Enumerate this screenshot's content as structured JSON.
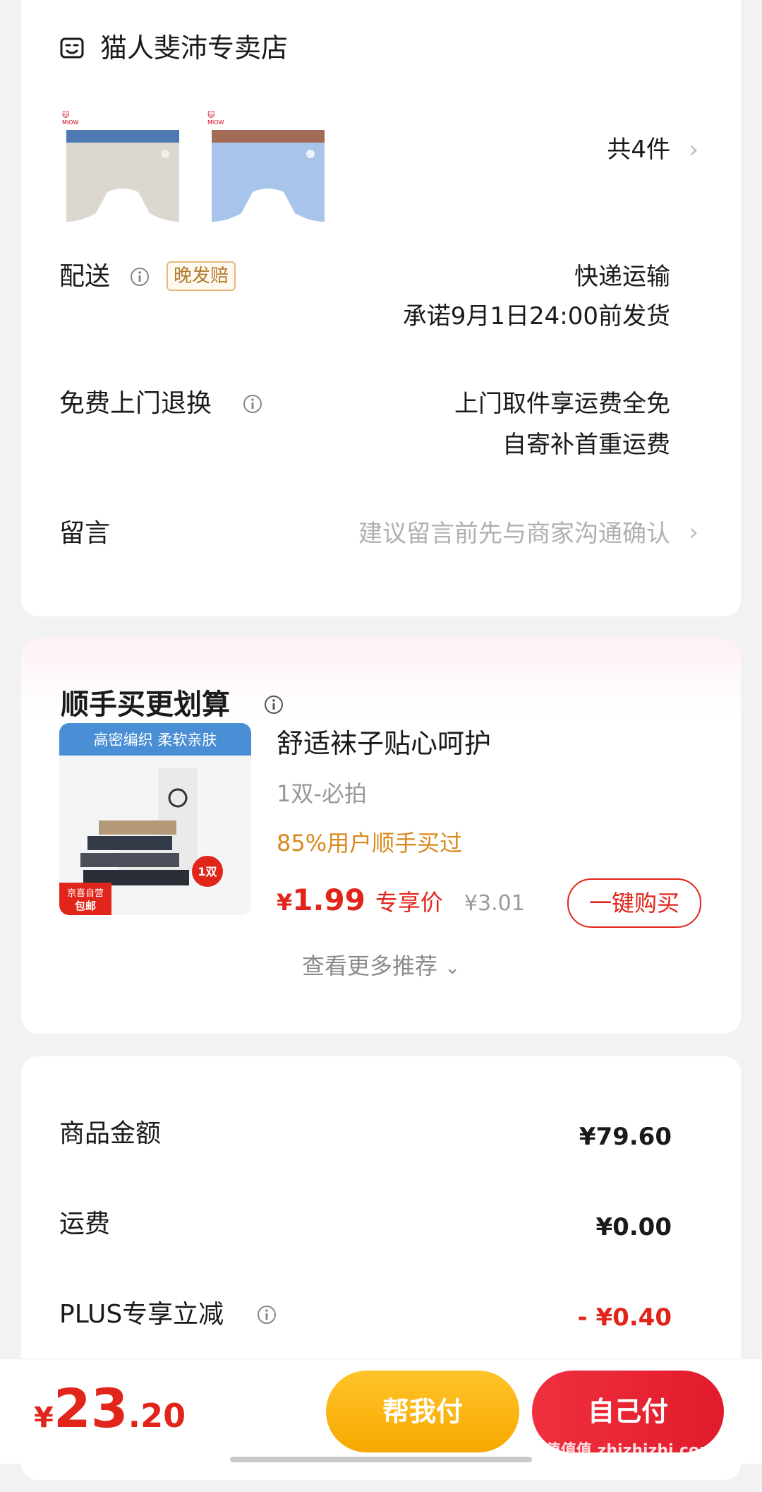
{
  "store": {
    "name": "猫人斐沛专卖店",
    "item_count": "共4件",
    "delivery": {
      "label": "配送",
      "badge": "晚发赔",
      "method": "快递运输",
      "promise": "承诺9月1日24:00前发货"
    },
    "returns": {
      "label": "免费上门退换",
      "line1": "上门取件享运费全免",
      "line2": "自寄补首重运费"
    },
    "message": {
      "label": "留言",
      "placeholder": "建议留言前先与商家沟通确认"
    }
  },
  "upsell": {
    "title": "顺手买更划算",
    "product": {
      "banner": "高密编织 柔软亲肤",
      "ribbon": "京喜自营 包邮",
      "pack": "1双",
      "name": "舒适袜子贴心呵护",
      "spec": "1双-必拍",
      "popularity": "85%用户顺手买过",
      "currency": "¥",
      "price": "1.99",
      "price_tag": "专享价",
      "original_price": "¥3.01",
      "buy_label": "一键购买"
    },
    "more_label": "查看更多推荐"
  },
  "summary": {
    "rows": [
      {
        "label": "商品金额",
        "value": "¥79.60"
      },
      {
        "label": "运费",
        "value": "¥0.00"
      },
      {
        "label": "PLUS专享立减",
        "value": "- ¥0.40"
      }
    ]
  },
  "bottom": {
    "currency": "¥",
    "total_int": "23",
    "total_dec": ".20",
    "help_pay": "帮我付",
    "self_pay": "自己付",
    "watermark": "值值值 zhizhizhi.com"
  },
  "colors": {
    "accent_red": "#e1251b",
    "pay_yellow": "#ffc42a",
    "popularity_orange": "#d98a1e"
  }
}
